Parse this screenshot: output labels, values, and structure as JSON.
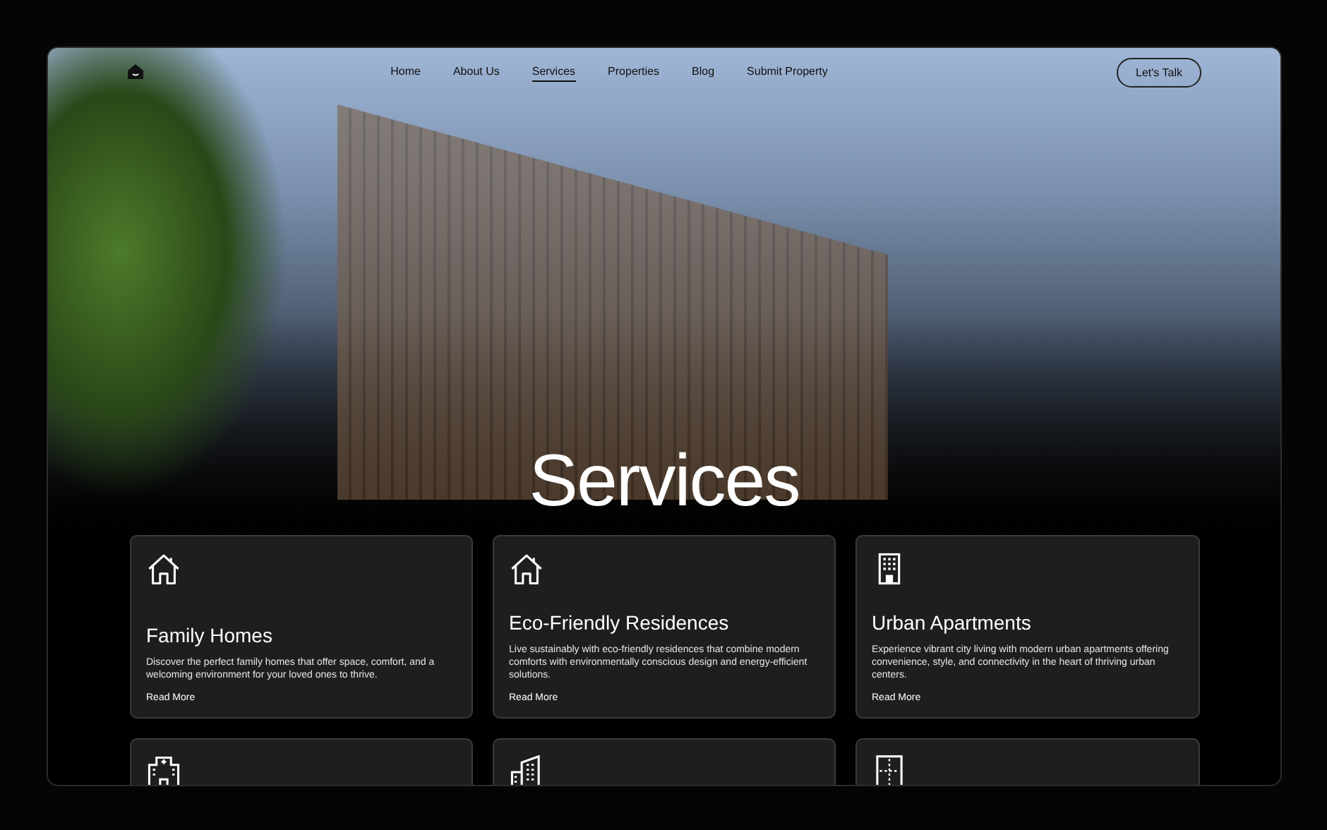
{
  "nav": {
    "items": [
      {
        "label": "Home",
        "selected": false
      },
      {
        "label": "About Us",
        "selected": false
      },
      {
        "label": "Services",
        "selected": true
      },
      {
        "label": "Properties",
        "selected": false
      },
      {
        "label": "Blog",
        "selected": false
      },
      {
        "label": "Submit Property",
        "selected": false
      }
    ],
    "cta": "Let's Talk"
  },
  "hero": {
    "title": "Services"
  },
  "cards": [
    {
      "kind": "house",
      "title": "Family Homes",
      "text": "Discover the perfect family homes that offer space, comfort, and a welcoming environment for your loved ones to thrive.",
      "link": "Read More"
    },
    {
      "kind": "house",
      "title": "Eco-Friendly Residences",
      "text": "Live sustainably with eco-friendly residences that combine modern comforts with environmentally conscious design and energy-efficient solutions.",
      "link": "Read More"
    },
    {
      "kind": "building",
      "title": "Urban Apartments",
      "text": "Experience vibrant city living with modern urban apartments offering convenience, style, and connectivity in the heart of thriving urban centers.",
      "link": "Read More"
    },
    {
      "kind": "hospital"
    },
    {
      "kind": "city"
    },
    {
      "kind": "plan"
    }
  ]
}
